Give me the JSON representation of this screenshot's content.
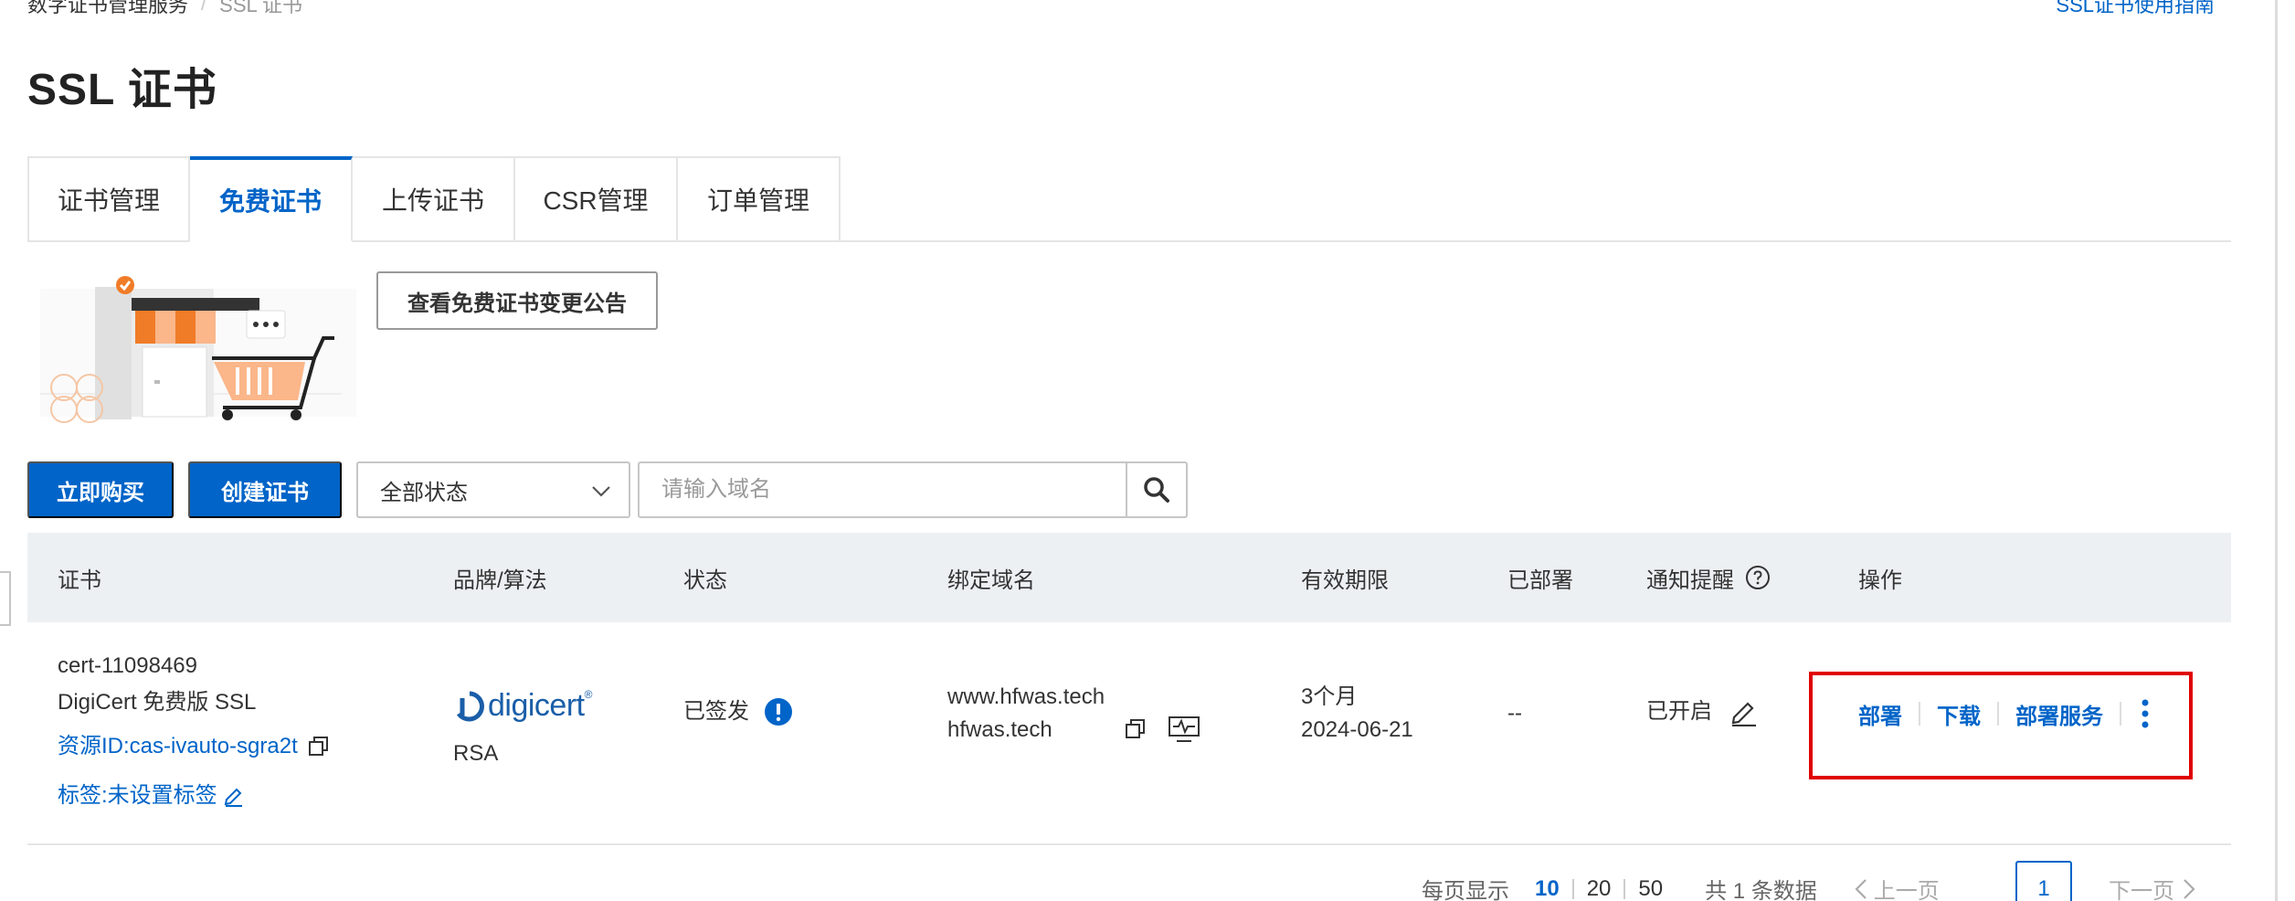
{
  "breadcrumb": {
    "parent": "数字证书管理服务",
    "separator": "/",
    "current": "SSL 证书"
  },
  "header": {
    "guide_link": "SSL证书使用指南",
    "title": "SSL 证书"
  },
  "tabs": [
    {
      "label": "证书管理"
    },
    {
      "label": "免费证书"
    },
    {
      "label": "上传证书"
    },
    {
      "label": "CSR管理"
    },
    {
      "label": "订单管理"
    }
  ],
  "active_tab": "免费证书",
  "notice_button": "查看免费证书变更公告",
  "toolbar": {
    "buy_label": "立即购买",
    "create_label": "创建证书",
    "status_select": "全部状态",
    "search_placeholder": "请输入域名"
  },
  "table": {
    "columns": {
      "cert": "证书",
      "brand": "品牌/算法",
      "status": "状态",
      "domain": "绑定域名",
      "validity": "有效期限",
      "deployed": "已部署",
      "notify": "通知提醒",
      "ops": "操作"
    },
    "rows": [
      {
        "cert_id": "cert-11098469",
        "cert_product": "DigiCert 免费版 SSL",
        "resource_id": "资源ID:cas-ivauto-sgra2t",
        "tag": "标签:未设置标签",
        "brand_logo": "digicert",
        "algorithm": "RSA",
        "status": "已签发",
        "domains": [
          "www.hfwas.tech",
          "hfwas.tech"
        ],
        "validity_term": "3个月",
        "validity_date": "2024-06-21",
        "deployed": "--",
        "notify": "已开启",
        "actions": {
          "deploy": "部署",
          "download": "下载",
          "deploy_service": "部署服务"
        }
      }
    ]
  },
  "pagination": {
    "per_page_label": "每页显示",
    "sizes": [
      "10",
      "20",
      "50"
    ],
    "selected_size": "10",
    "total": "共 1 条数据",
    "prev": "上一页",
    "current": "1",
    "next": "下一页"
  },
  "colors": {
    "primary": "#0064c8",
    "highlight": "#e00000",
    "header_bg": "#edf0f3",
    "orange": "#f07c28"
  },
  "icons": [
    "copy-icon",
    "monitor-icon",
    "edit-icon",
    "info-icon",
    "help-icon",
    "search-icon",
    "chevron-down-icon",
    "more-vertical-icon"
  ]
}
